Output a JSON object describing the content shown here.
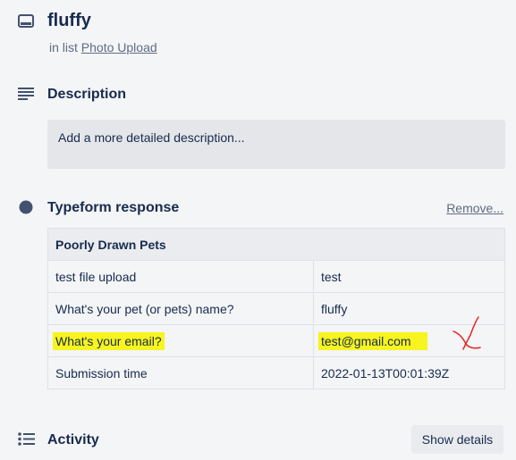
{
  "card": {
    "title": "fluffy",
    "in_list_prefix": "in list",
    "list_name": "Photo Upload"
  },
  "description": {
    "heading": "Description",
    "placeholder": "Add a more detailed description..."
  },
  "typeform": {
    "heading": "Typeform response",
    "remove_label": "Remove...",
    "form_title": "Poorly Drawn Pets",
    "rows": [
      {
        "question": "test file upload",
        "answer": "test"
      },
      {
        "question": "What's your pet (or pets) name?",
        "answer": "fluffy"
      },
      {
        "question": "What's your email?",
        "answer": "test@gmail.com"
      },
      {
        "question": "Submission time",
        "answer": "2022-01-13T00:01:39Z"
      }
    ],
    "highlight_color": "#f7f41f",
    "mark_color": "#e8231b"
  },
  "activity": {
    "heading": "Activity",
    "show_details_label": "Show details"
  },
  "icons": [
    "card-icon",
    "description-lines-icon",
    "typeform-dot-icon",
    "activity-list-icon",
    "x-mark-annotation"
  ]
}
